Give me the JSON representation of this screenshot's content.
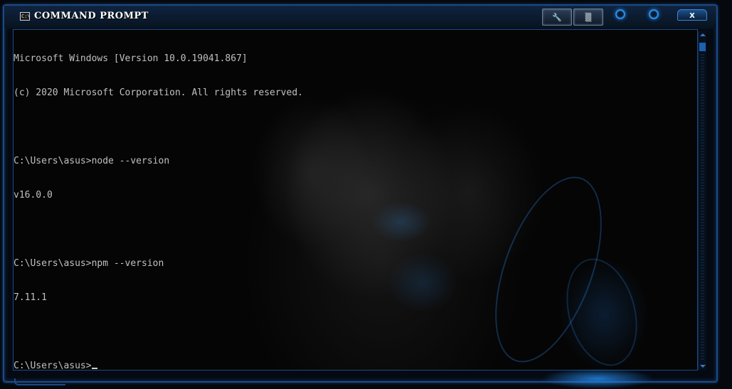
{
  "window": {
    "title": "COMMAND PROMPT",
    "icon": "cmd-icon",
    "icon_label": "C:\\",
    "buttons": {
      "tools_icon": "wrench-icon",
      "tools_glyph": "🔧",
      "options_icon": "options-icon",
      "options_glyph": "▒",
      "minimize_icon": "orb-icon",
      "maximize_icon": "orb-icon",
      "close_label": "x"
    }
  },
  "console": {
    "lines": [
      "Microsoft Windows [Version 10.0.19041.867]",
      "(c) 2020 Microsoft Corporation. All rights reserved.",
      "",
      "C:\\Users\\asus>node --version",
      "v16.0.0",
      "",
      "C:\\Users\\asus>npm --version",
      "7.11.1",
      ""
    ],
    "prompt": "C:\\Users\\asus>"
  },
  "colors": {
    "text": "#c0c0c0",
    "frame": "#1c4a86",
    "accent": "#2a8fe8"
  }
}
